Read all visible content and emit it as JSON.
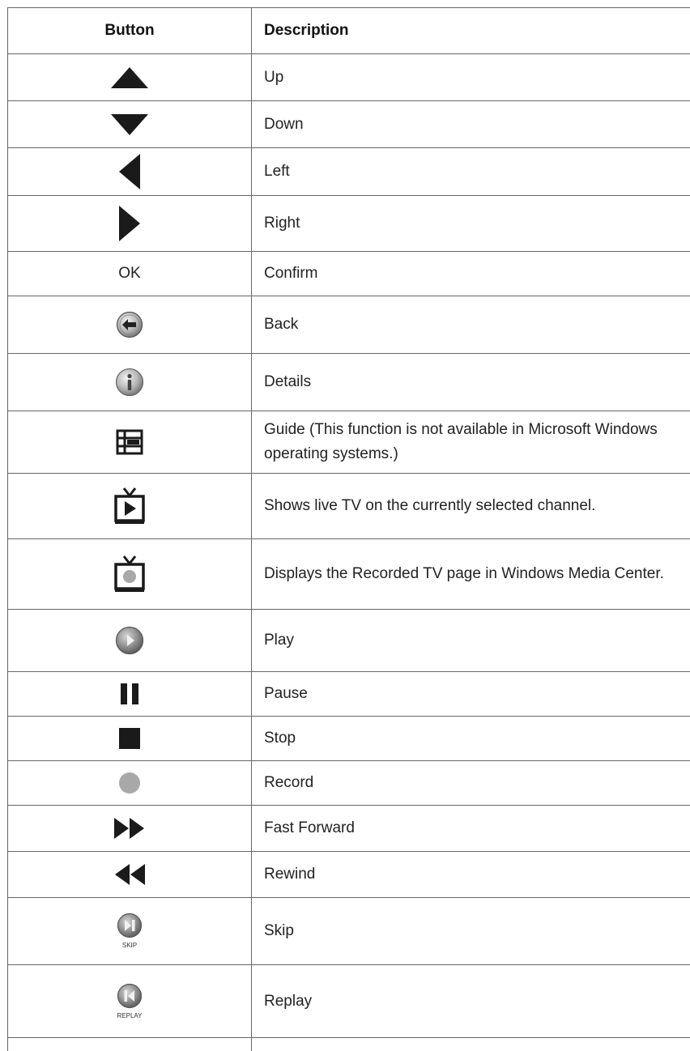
{
  "table": {
    "headers": {
      "button": "Button",
      "description": "Description"
    },
    "rows": [
      {
        "icon": "up-triangle-icon",
        "description": "Up"
      },
      {
        "icon": "down-triangle-icon",
        "description": "Down"
      },
      {
        "icon": "left-triangle-icon",
        "description": "Left"
      },
      {
        "icon": "right-triangle-icon",
        "description": "Right"
      },
      {
        "icon": "ok-text",
        "button_text": "OK",
        "description": "Confirm"
      },
      {
        "icon": "back-arrow-icon",
        "description": "Back"
      },
      {
        "icon": "info-icon",
        "description": "Details"
      },
      {
        "icon": "guide-grid-icon",
        "description": "Guide (This function is not available in Microsoft Windows operating systems.)"
      },
      {
        "icon": "live-tv-icon",
        "description": "Shows live TV on the currently selected channel."
      },
      {
        "icon": "recorded-tv-icon",
        "description": "Displays the Recorded TV page in Windows Media Center."
      },
      {
        "icon": "play-icon",
        "description": "Play"
      },
      {
        "icon": "pause-icon",
        "description": "Pause"
      },
      {
        "icon": "stop-icon",
        "description": "Stop"
      },
      {
        "icon": "record-icon",
        "description": "Record"
      },
      {
        "icon": "fast-forward-icon",
        "description": "Fast Forward"
      },
      {
        "icon": "rewind-icon",
        "description": "Rewind"
      },
      {
        "icon": "skip-icon",
        "icon_label": "SKIP",
        "description": "Skip"
      },
      {
        "icon": "replay-icon",
        "icon_label": "REPLAY",
        "description": "Replay"
      }
    ]
  },
  "colors": {
    "border": "#666666",
    "icon": "#1a1a1a",
    "record": "#a8a8a8",
    "text": "#222222"
  }
}
